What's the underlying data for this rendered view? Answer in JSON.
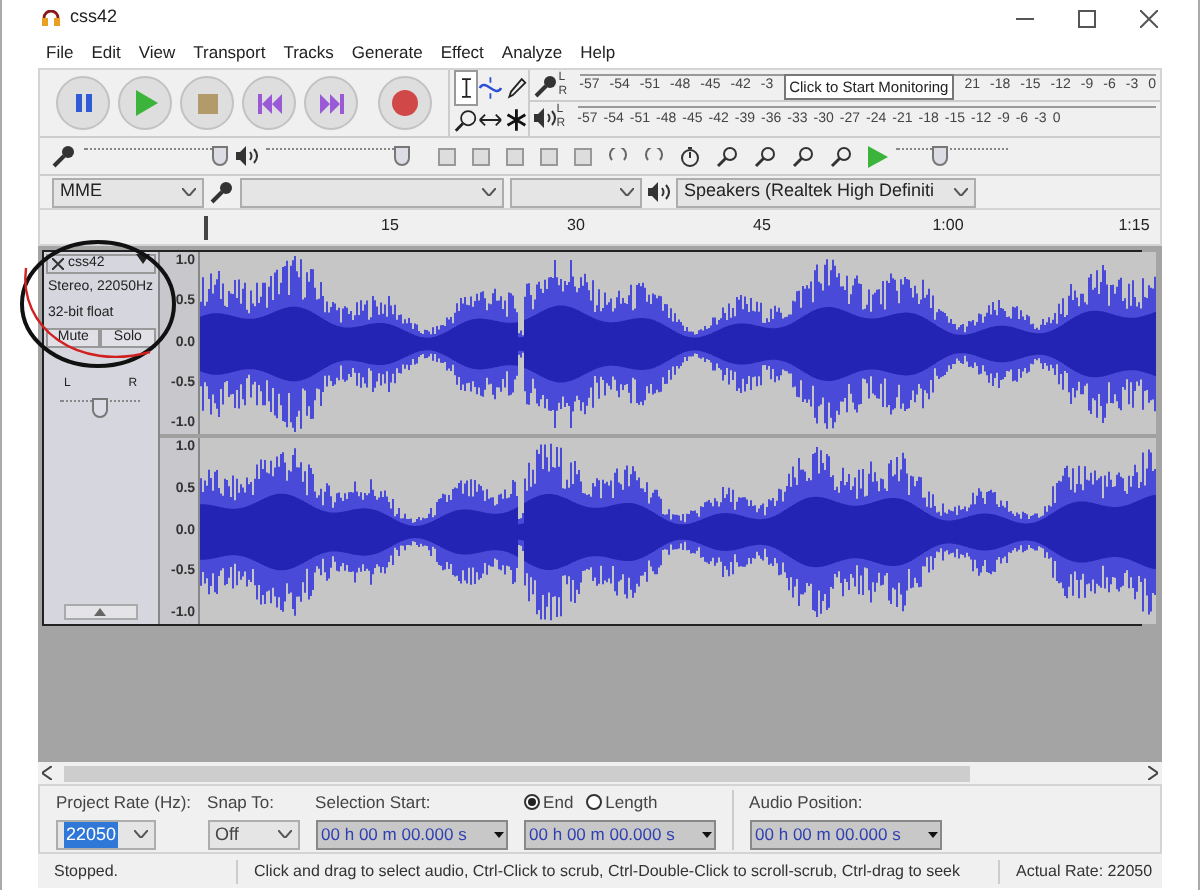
{
  "window": {
    "title": "css42"
  },
  "menu": [
    "File",
    "Edit",
    "View",
    "Transport",
    "Tracks",
    "Generate",
    "Effect",
    "Analyze",
    "Help"
  ],
  "transport_buttons": [
    {
      "kind": "pause"
    },
    {
      "kind": "play"
    },
    {
      "kind": "stop"
    },
    {
      "kind": "skip-start"
    },
    {
      "kind": "skip-end"
    },
    {
      "kind": "record"
    }
  ],
  "tools": [
    {
      "kind": "select",
      "selected": true
    },
    {
      "kind": "envelope",
      "selected": false
    },
    {
      "kind": "draw",
      "selected": false
    },
    {
      "kind": "zoom",
      "selected": false
    },
    {
      "kind": "timeshift",
      "selected": false
    },
    {
      "kind": "multi",
      "selected": false
    }
  ],
  "record_meter": {
    "channels": [
      "L",
      "R"
    ],
    "ticks_before": [
      "-57",
      "-54",
      "-51",
      "-48",
      "-45",
      "-42",
      "-3"
    ],
    "tooltip": "Click to Start Monitoring",
    "ticks_after": [
      "21",
      "-18",
      "-15",
      "-12",
      "-9",
      "-6",
      "-3",
      "0"
    ]
  },
  "playback_meter": {
    "channels": [
      "L",
      "R"
    ],
    "ticks": [
      "-57",
      "-54",
      "-51",
      "-48",
      "-45",
      "-42",
      "-39",
      "-36",
      "-33",
      "-30",
      "-27",
      "-24",
      "-21",
      "-18",
      "-15",
      "-12",
      "-9",
      "-6",
      "-3",
      "0"
    ]
  },
  "record_volume": {
    "level": 0.95
  },
  "playback_volume": {
    "level": 0.95
  },
  "play_at_speed": {
    "level": 0.4
  },
  "devices": {
    "host": "MME",
    "output": "Speakers (Realtek High Definiti"
  },
  "ruler": {
    "labels": [
      "15",
      "30",
      "45",
      "1:00",
      "1:15"
    ]
  },
  "track": {
    "name": "css42",
    "info": [
      "Stereo, 22050Hz",
      "32-bit float"
    ],
    "buttons": [
      "Mute",
      "Solo"
    ],
    "pan": {
      "left": "L",
      "right": "R",
      "level": 0.5
    }
  },
  "channels": [
    {
      "scale": [
        "1.0",
        "0.5",
        "0.0",
        "-0.5",
        "-1.0"
      ]
    },
    {
      "scale": [
        "1.0",
        "0.5",
        "0.0",
        "-0.5",
        "-1.0"
      ]
    }
  ],
  "selection_bar": {
    "project_rate": {
      "label": "Project Rate (Hz):",
      "value": "22050"
    },
    "snap_to": {
      "label": "Snap To:",
      "value": "Off"
    },
    "selection_start": {
      "label": "Selection Start:",
      "value": "00 h 00 m 00.000 s"
    },
    "end_length": [
      {
        "label": "End",
        "selected": true
      },
      {
        "label": "Length",
        "selected": false
      }
    ],
    "selection_end": {
      "value": "00 h 00 m 00.000 s"
    },
    "audio_position": {
      "label": "Audio Position:",
      "value": "00 h 00 m 00.000 s"
    }
  },
  "status_bar": [
    "Stopped.",
    "Click and drag to select audio, Ctrl-Click to scrub, Ctrl-Double-Click to scroll-scrub, Ctrl-drag to seek",
    "Actual Rate: 22050"
  ]
}
